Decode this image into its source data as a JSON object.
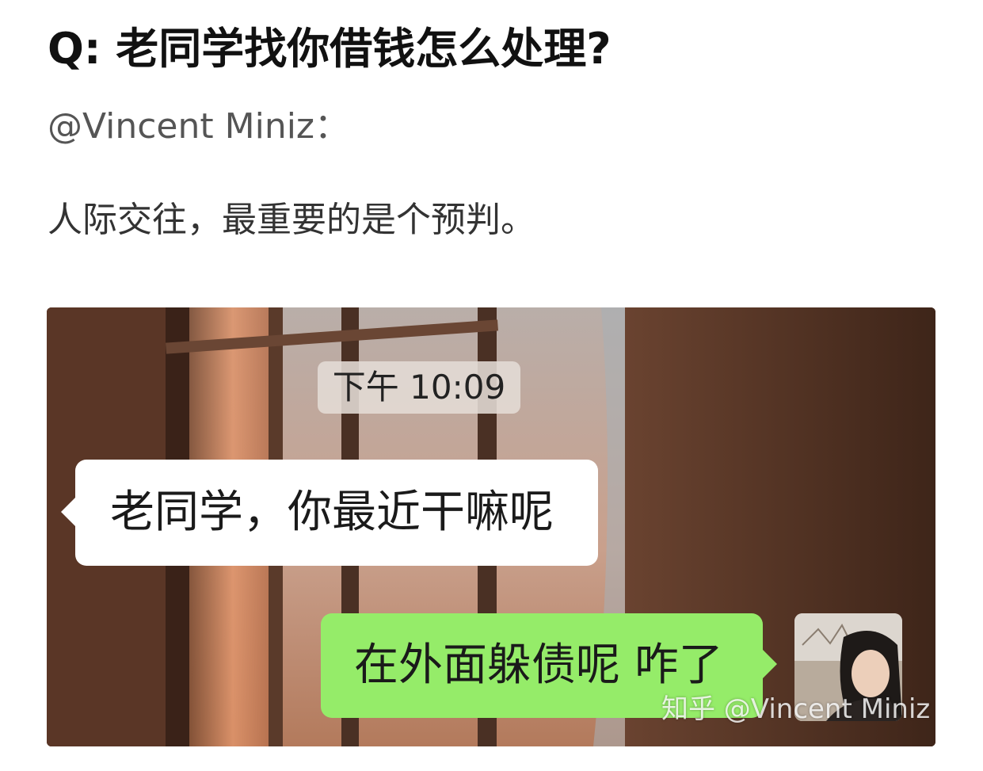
{
  "post": {
    "question": "Q: 老同学找你借钱怎么处理?",
    "author": "@Vincent Miniz：",
    "body_text": "人际交往，最重要的是个预判。"
  },
  "chat_image": {
    "timestamp": "下午 10:09",
    "incoming_message": "老同学，你最近干嘛呢",
    "outgoing_message": "在外面躲债呢 咋了",
    "watermark": "知乎 @Vincent Miniz",
    "colors": {
      "outgoing_bubble": "#95ec69",
      "incoming_bubble": "#ffffff",
      "background": "#4a2c1f"
    }
  }
}
